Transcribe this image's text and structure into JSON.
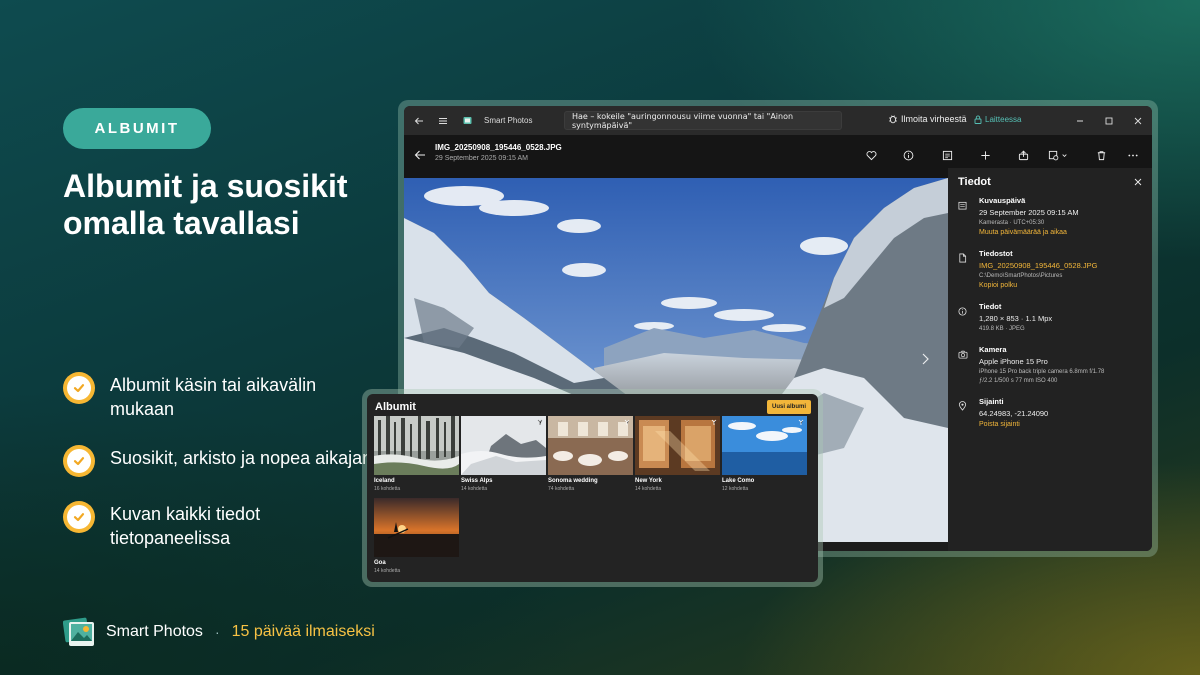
{
  "marketing": {
    "badge": "ALBUMIT",
    "headline": "Albumit ja suosikit omalla tavallasi",
    "features": [
      {
        "text": "Albumit käsin tai aikavälin mukaan"
      },
      {
        "text": "Suosikit, arkisto ja nopea aikajana"
      },
      {
        "text": "Kuvan kaikki tiedot tietopaneelissa"
      }
    ],
    "brand_name": "Smart Photos",
    "separator": "·",
    "offer": "15 päivää ilmaiseksi"
  },
  "window": {
    "app_title": "Smart Photos",
    "search_text": "Hae – kokeile \"auringonnousu viime vuonna\" tai \"Ainon syntymäpäivä\"",
    "report_label": "Ilmoita virheestä",
    "devices_label": "Laitteessa",
    "file_name": "IMG_20250908_195446_0528.JPG",
    "file_datetime": "29 September 2025 09:15 AM"
  },
  "details": {
    "title": "Tiedot",
    "date_section": {
      "title": "Kuvauspäivä",
      "value": "29 September 2025 09:15 AM",
      "sub": "Kamerasta · UTC+05:30",
      "link": "Muuta päivämäärää ja aikaa"
    },
    "file_section": {
      "title": "Tiedostot",
      "value": "IMG_20250908_195446_0528.JPG",
      "sub": "C:\\Demo\\SmartPhotos\\Pictures",
      "link": "Kopioi polku"
    },
    "info_section": {
      "title": "Tiedot",
      "value": "1,280 × 853 · 1.1 Mpx",
      "sub": "419.8 KB · JPEG"
    },
    "camera_section": {
      "title": "Kamera",
      "value": "Apple iPhone 15 Pro",
      "sub": "iPhone 15 Pro back triple camera 6.8mm f/1.78",
      "sub2": "ƒ/2.2   1/500 s   77 mm   ISO 400"
    },
    "location_section": {
      "title": "Sijainti",
      "value": "64.24983, -21.24090",
      "link": "Poista sijainti"
    }
  },
  "albums": {
    "title": "Albumit",
    "new_button": "Uusi albumi",
    "items": [
      {
        "name": "Iceland",
        "count": "16 kohdetta"
      },
      {
        "name": "Swiss Alps",
        "count": "14 kohdetta"
      },
      {
        "name": "Sonoma wedding",
        "count": "74 kohdetta"
      },
      {
        "name": "New York",
        "count": "14 kohdetta"
      },
      {
        "name": "Lake Como",
        "count": "12 kohdetta"
      },
      {
        "name": "Goa",
        "count": "14 kohdetta"
      }
    ]
  },
  "colors": {
    "accent": "#f2b63a",
    "badge": "#3aa99a",
    "link_teal": "#56c0b5"
  }
}
